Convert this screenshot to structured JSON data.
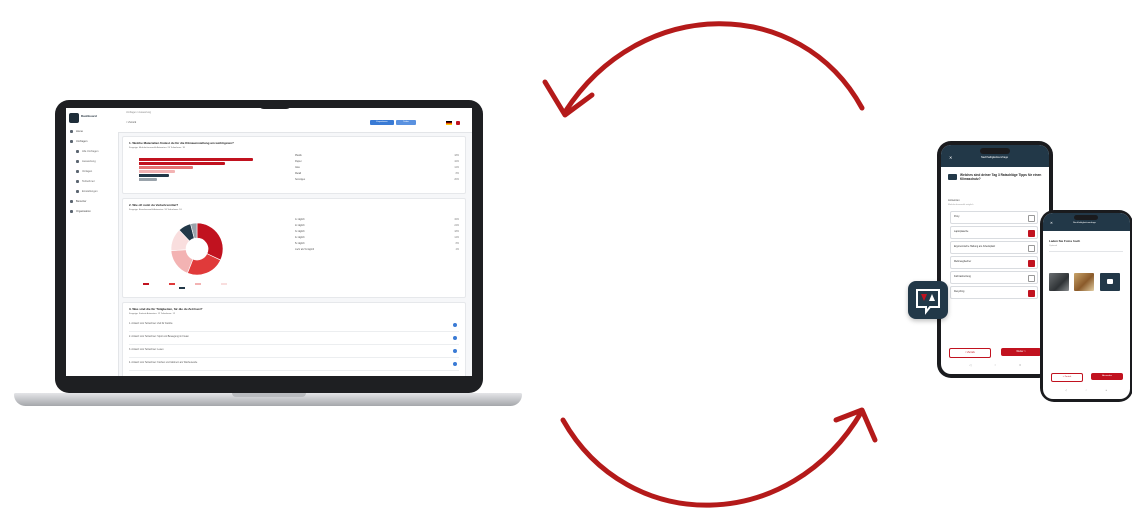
{
  "colors": {
    "accent_red": "#c1121f",
    "navy": "#223848",
    "blue": "#3a7bd5"
  },
  "laptop": {
    "app_name": "Dashboard",
    "breadcrumb": "Umfragen / Auswertung",
    "back": "< Zurück",
    "top_buttons": [
      "Exportieren",
      "Teilen"
    ],
    "nav": [
      {
        "label": "Home",
        "sub": false
      },
      {
        "label": "Umfragen",
        "sub": false
      },
      {
        "label": "Alle Umfragen",
        "sub": true
      },
      {
        "label": "Auswertung",
        "sub": true
      },
      {
        "label": "Vorlagen",
        "sub": true
      },
      {
        "label": "Teilnehmer",
        "sub": true
      },
      {
        "label": "Einstellungen",
        "sub": true
      },
      {
        "label": "Benutzer",
        "sub": false
      },
      {
        "label": "Organisation",
        "sub": false
      }
    ],
    "q1": {
      "title": "1. Welche Materialien findest du für die Klimaumstellung am wichtigsten?",
      "meta": "Fragetyp: Mehrfachauswahl   Antworten: 24   Teilnehmer: 18",
      "legend": [
        {
          "label": "Plastik",
          "value": "18%"
        },
        {
          "label": "Papier",
          "value": "42%"
        },
        {
          "label": "Glas",
          "value": "12%"
        },
        {
          "label": "Metall",
          "value": "8%"
        },
        {
          "label": "Sonstiges",
          "value": "20%"
        }
      ],
      "values": [
        0.95,
        0.72,
        0.45,
        0.3,
        0.25,
        0.15
      ]
    },
    "q2": {
      "title": "2. Wie oft nutzt du Verkehrsmittel?",
      "meta": "Fragetyp: Einzelauswahl   Antworten: 18   Teilnehmer: 18",
      "legend": [
        {
          "label": "1x täglich",
          "value": "32%"
        },
        {
          "label": "2x täglich",
          "value": "24%"
        },
        {
          "label": "3x täglich",
          "value": "18%"
        },
        {
          "label": "4x täglich",
          "value": "14%"
        },
        {
          "label": "5x täglich",
          "value": "8%"
        },
        {
          "label": "mehr als 5x täglich",
          "value": "4%"
        }
      ],
      "slices": [
        32,
        24,
        18,
        14,
        8,
        4
      ]
    },
    "q3": {
      "title": "3. Was sind die für Tätigkeiten, für die du Zeit hast?",
      "meta": "Fragetyp: Freitext   Antworten: 12   Teilnehmer: 12",
      "answers": [
        "1. Antwort vom Teilnehmer: Zeit für Familie",
        "2. Antwort vom Teilnehmer: Sport und Bewegung im Freien",
        "3. Antwort vom Teilnehmer: Lesen",
        "4. Antwort vom Teilnehmer: Kochen und Gärtnern am Wochenende"
      ]
    }
  },
  "phone1": {
    "header": "Nachhaltigkeitsumfrage",
    "question": "Welches sind deiner Tag 3 Ratschläge Tipps für einen Klimaschutz?",
    "hint": "Mehrfachauswahl möglich",
    "section": "Antworten",
    "options": [
      {
        "label": "Pony",
        "checked": false
      },
      {
        "label": "Laptoptasche",
        "checked": true
      },
      {
        "label": "Ergonomische Haltung am Arbeitsplatz",
        "checked": false
      },
      {
        "label": "Mehrwegbecher",
        "checked": true
      },
      {
        "label": "Fahrradnutzung",
        "checked": false
      },
      {
        "label": "Recycling",
        "checked": true
      }
    ],
    "back": "< Zurück",
    "next": "Weiter >"
  },
  "phone2": {
    "header": "Nachhaltigkeitsumfrage",
    "question": "Laden Sie Fotos hoch",
    "hint": "Optional",
    "upload_label": "Foto hinzufügen",
    "back": "< Zurück",
    "next": "Absenden"
  },
  "badge_icon": "survey-logo-icon"
}
